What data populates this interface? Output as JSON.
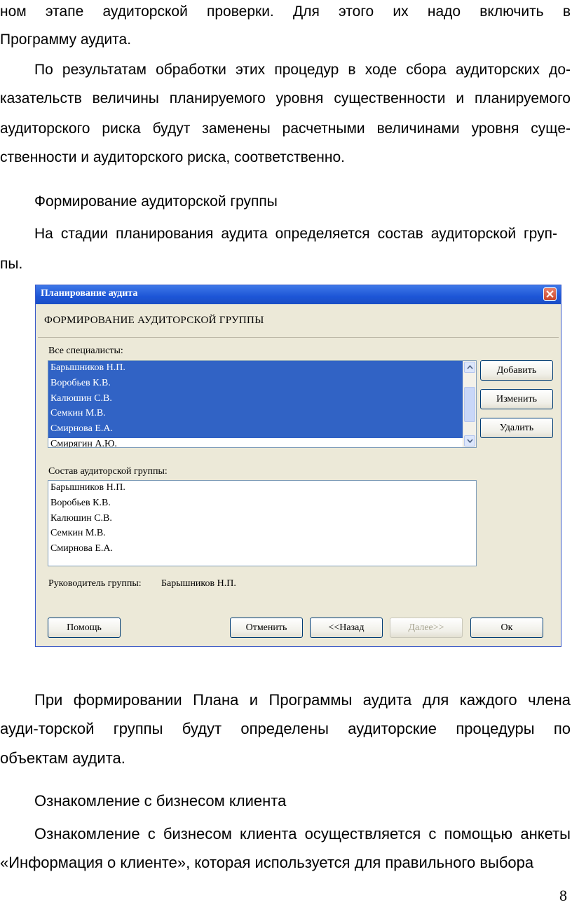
{
  "text": {
    "p1_line1": "ном этапе аудиторской проверки. Для этого их надо включить в",
    "p1_line2": "Программу аудита.",
    "p2_line1": "По результатам обработки этих процедур в ходе сбора аудиторских до-",
    "p2_line2": "казательств величины планируемого уровня существенности и планируемого",
    "p2_line3": "аудиторского риска будут заменены расчетными величинами уровня суще-",
    "p2_line4": "ственности и аудиторского риска, соответственно.",
    "heading1": "Формирование аудиторской группы",
    "p3_line1": "На стадии планирования аудита определяется состав аудиторской груп-",
    "p3_line2": "пы.",
    "p4_line1": "При формировании Плана и Программы аудита для каждого члена",
    "p4_line2": "ауди-торской группы будут определены аудиторские процедуры по",
    "p4_line3": "объектам аудита.",
    "heading2": "Ознакомление с бизнесом клиента",
    "p5_line1": "Ознакомление с бизнесом клиента осуществляется с помощью анкеты",
    "p5_line2": "«Информация о клиенте», которая используется для правильного выбора",
    "page_number": "8"
  },
  "dialog": {
    "title": "Планирование аудита",
    "header": "ФОРМИРОВАНИЕ АУДИТОРСКОЙ ГРУППЫ",
    "all_label": "Все специалисты:",
    "all_items": [
      "Барышников Н.П.",
      "Воробьев К.В.",
      "Калюшин С.В.",
      "Семкин М.В.",
      "Смирнова Е.А.",
      "Смирягин А.Ю."
    ],
    "team_label": "Состав аудиторской группы:",
    "team_items": [
      "Барышников Н.П.",
      "Воробьев К.В.",
      "Калюшин С.В.",
      "Семкин М.В.",
      "Смирнова Е.А."
    ],
    "leader_label": "Руководитель группы:",
    "leader_value": "Барышников Н.П.",
    "btn_add": "Добавить",
    "btn_edit": "Изменить",
    "btn_delete": "Удалить",
    "btn_help": "Помощь",
    "btn_cancel": "Отменить",
    "btn_back": "<<Назад",
    "btn_next": "Далее>>",
    "btn_ok": "Ок",
    "colors": {
      "titlebar": "#1d55d6",
      "selection": "#3163c5",
      "face": "#ece9d8"
    },
    "icons": {
      "close": "close-icon",
      "up": "chevron-up-icon",
      "down": "chevron-down-icon"
    }
  }
}
